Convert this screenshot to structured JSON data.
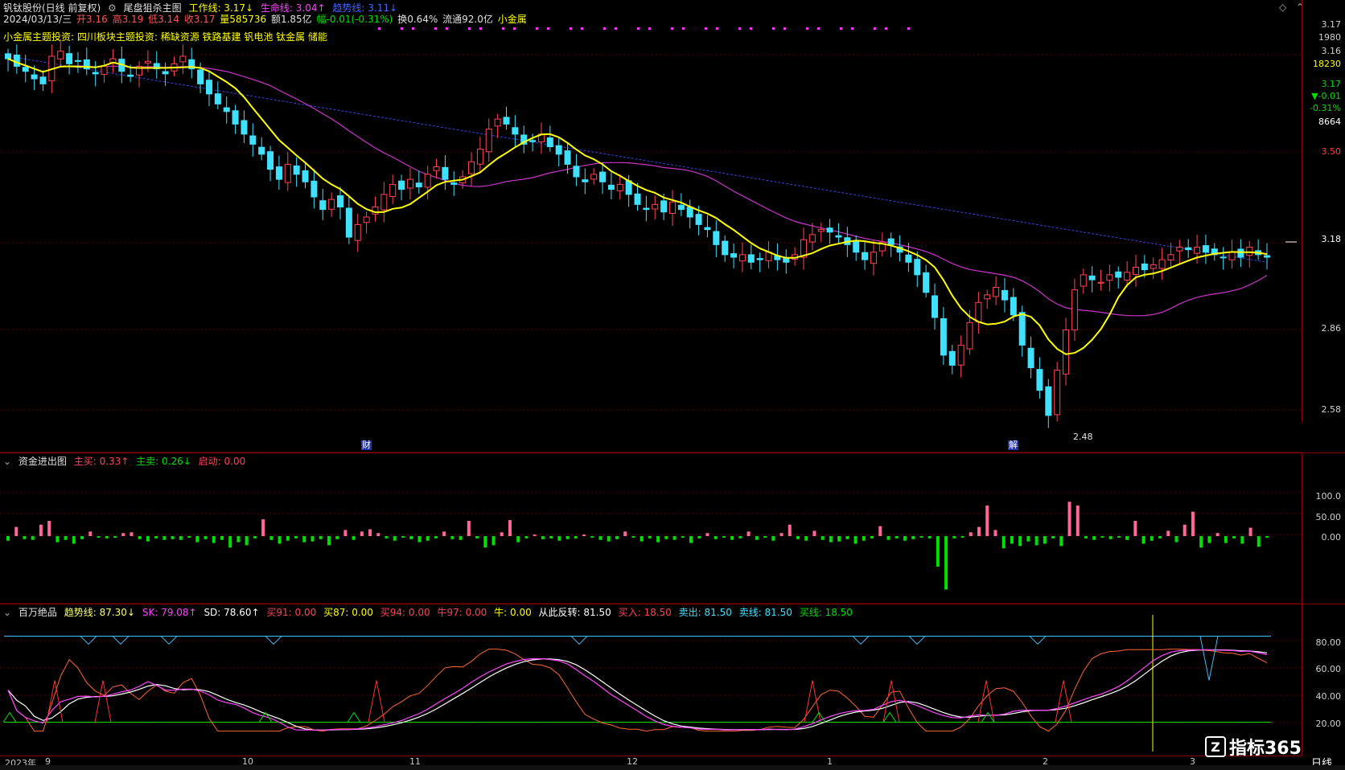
{
  "colors": {
    "up": "#ff4455",
    "down": "#40e0ff",
    "ma_yellow": "#ffff00",
    "ma_magenta": "#cc33cc",
    "ma_blue": "#3344dd",
    "grid": "#8b0000",
    "sell_green": "#00e000",
    "buy_pink": "#ff6699",
    "highlight": "#ffff00"
  },
  "header": {
    "title": "钒钛股份(日线 前复权)",
    "indicator_name": "尾盘狙杀主图",
    "work_line": "工作线: 3.17↓",
    "life_line": "生命线: 3.04↑",
    "trend_line": "趋势线: 3.11↓",
    "date": "2024/03/13/三",
    "open": "开3.16",
    "high": "高3.19",
    "low": "低3.14",
    "close": "收3.17",
    "volume": "量585736",
    "amount": "额1.85亿",
    "change": "幅-0.01(-0.31%)",
    "turnover": "换0.64%",
    "float": "流通92.0亿",
    "sector": "小金属"
  },
  "theme_line": "小金属主题投资: 四川板块主题投资: 稀缺资源 铁路基建 钒电池 钛金属 储能",
  "right_quote": [
    "3.17",
    "1980",
    "3.16",
    "18230",
    "3.17",
    "▼-0.01",
    "-0.31%",
    "8664"
  ],
  "price_axis": [
    "3.50",
    "3.18",
    "2.86",
    "2.58"
  ],
  "low_label": "2.48",
  "markers": {
    "cai": "财",
    "jie": "解"
  },
  "panel2": {
    "name": "资金进出图",
    "main_buy": "主买: 0.33↑",
    "main_sell": "主卖: 0.26↓",
    "start": "启动: 0.00",
    "axis": [
      "100.0",
      "50.00",
      "0.00"
    ]
  },
  "panel3": {
    "name": "百万绝品",
    "trend": "趋势线: 87.30↓",
    "sk": "SK: 79.08↑",
    "sd": "SD: 78.60↑",
    "b91": "买91: 0.00",
    "b87": "买87: 0.00",
    "b94": "买94: 0.00",
    "n97": "牛97: 0.00",
    "niu": "牛: 0.00",
    "rev": "从此反转: 81.50",
    "buyin": "买入: 18.50",
    "sellout": "卖出: 81.50",
    "sellline": "卖线: 81.50",
    "buyline": "买线: 18.50",
    "axis": [
      "80.00",
      "60.00",
      "40.00",
      "20.00"
    ]
  },
  "dates": [
    "2023年",
    "9",
    "10",
    "11",
    "12",
    "1",
    "2",
    "3"
  ],
  "period": "日线",
  "logo_text": "指标365",
  "closes": [
    3.96,
    3.93,
    3.91,
    3.88,
    3.86,
    3.97,
    3.99,
    3.94,
    3.95,
    3.92,
    3.9,
    3.93,
    3.96,
    3.91,
    3.89,
    3.93,
    3.95,
    3.92,
    3.9,
    3.94,
    3.97,
    3.92,
    3.86,
    3.82,
    3.78,
    3.75,
    3.7,
    3.66,
    3.62,
    3.58,
    3.52,
    3.48,
    3.54,
    3.5,
    3.47,
    3.41,
    3.36,
    3.4,
    3.37,
    3.25,
    3.3,
    3.33,
    3.37,
    3.42,
    3.46,
    3.44,
    3.48,
    3.45,
    3.5,
    3.53,
    3.48,
    3.46,
    3.49,
    3.55,
    3.6,
    3.68,
    3.72,
    3.7,
    3.66,
    3.62,
    3.63,
    3.66,
    3.61,
    3.58,
    3.54,
    3.49,
    3.47,
    3.5,
    3.47,
    3.44,
    3.46,
    3.42,
    3.38,
    3.36,
    3.38,
    3.35,
    3.39,
    3.36,
    3.33,
    3.3,
    3.28,
    3.22,
    3.18,
    3.17,
    3.18,
    3.15,
    3.16,
    3.19,
    3.16,
    3.15,
    3.18,
    3.24,
    3.26,
    3.28,
    3.27,
    3.25,
    3.22,
    3.19,
    3.16,
    3.19,
    3.23,
    3.22,
    3.19,
    3.15,
    3.1,
    3.03,
    2.93,
    2.78,
    2.74,
    2.82,
    2.91,
    2.99,
    3.02,
    3.05,
    3.0,
    2.94,
    2.82,
    2.73,
    2.64,
    2.54,
    2.72,
    2.88,
    3.04,
    3.1,
    3.08,
    3.07,
    3.1,
    3.09,
    3.11,
    3.13,
    3.12,
    3.14,
    3.16,
    3.18,
    3.21,
    3.2,
    3.21,
    3.19,
    3.18,
    3.17,
    3.19,
    3.17,
    3.21,
    3.18,
    3.17
  ],
  "vol_bars": [
    -6,
    12,
    -4,
    -5,
    15,
    20,
    -8,
    -5,
    -10,
    -4,
    6,
    -2,
    -3,
    -2,
    4,
    5,
    -4,
    -7,
    -3,
    -5,
    -4,
    -5,
    -2,
    -8,
    -4,
    -9,
    -5,
    -15,
    -8,
    -12,
    -3,
    22,
    -5,
    -10,
    -6,
    -3,
    -8,
    -7,
    -4,
    -12,
    -4,
    8,
    -5,
    6,
    9,
    4,
    -3,
    -6,
    -2,
    -4,
    -8,
    -6,
    -3,
    6,
    -4,
    -5,
    20,
    -3,
    -15,
    -12,
    5,
    21,
    -8,
    -3,
    2,
    -4,
    -3,
    -6,
    -4,
    -3,
    2,
    -2,
    -5,
    -7,
    -4,
    6,
    -2,
    -7,
    -3,
    -8,
    -4,
    -5,
    -2,
    -9,
    -3,
    4,
    -4,
    -2,
    -5,
    -3,
    6,
    -5,
    -2,
    -6,
    4,
    15,
    -4,
    -6,
    7,
    -5,
    -8,
    -7,
    -4,
    -10,
    -6,
    -3,
    13,
    -5,
    -3,
    -6,
    -4,
    -2,
    -3,
    -40,
    -70,
    -3,
    -2,
    5,
    12,
    40,
    8,
    -16,
    -10,
    -13,
    -7,
    -12,
    -10,
    -3,
    -13,
    45,
    40,
    -3,
    -5,
    -2,
    -4,
    -2,
    -5,
    20,
    -10,
    -6,
    -3,
    7,
    -8,
    15,
    32,
    -15,
    -9,
    4,
    -9,
    -3,
    -10,
    11,
    -14,
    -2
  ]
}
